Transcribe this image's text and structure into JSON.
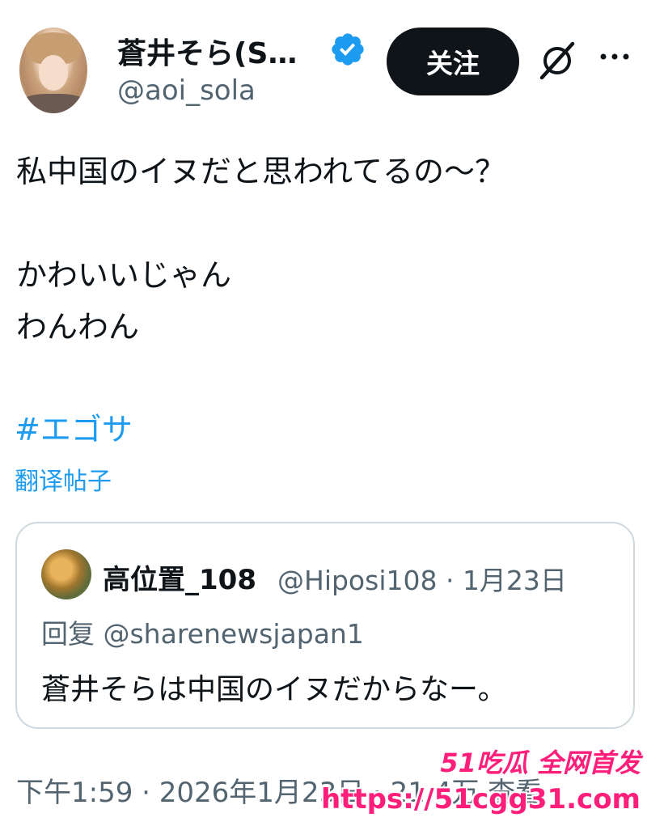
{
  "author": {
    "display_name": "蒼井そら(S…",
    "handle": "@aoi_sola",
    "verified_icon": "verified-badge-icon"
  },
  "actions": {
    "follow_label": "关注",
    "grok_icon": "grok-icon",
    "more_icon": "more-dots-icon"
  },
  "post": {
    "text": "私中国のイヌだと思われてるの〜？\n\nかわいいじゃん\nわんわん",
    "hashtag": "#エゴサ",
    "translate_label": "翻译帖子"
  },
  "quote": {
    "name": "高位置_108",
    "meta": "@Hiposi108 · 1月23日",
    "reply_to": "回复 @sharenewsjapan1",
    "text": "蒼井そらは中国のイヌだからなー。"
  },
  "timestamp": "下午1:59 · 2026年1月23日 · 21.4万 查看",
  "watermark": {
    "line1": "51吃瓜 全网首发",
    "line2": "https://51cgg31.com"
  },
  "colors": {
    "accent": "#1d9bf0",
    "text": "#0f1419",
    "secondary": "#536471",
    "border": "#cfd9de",
    "watermark": "#ff1f7a"
  }
}
